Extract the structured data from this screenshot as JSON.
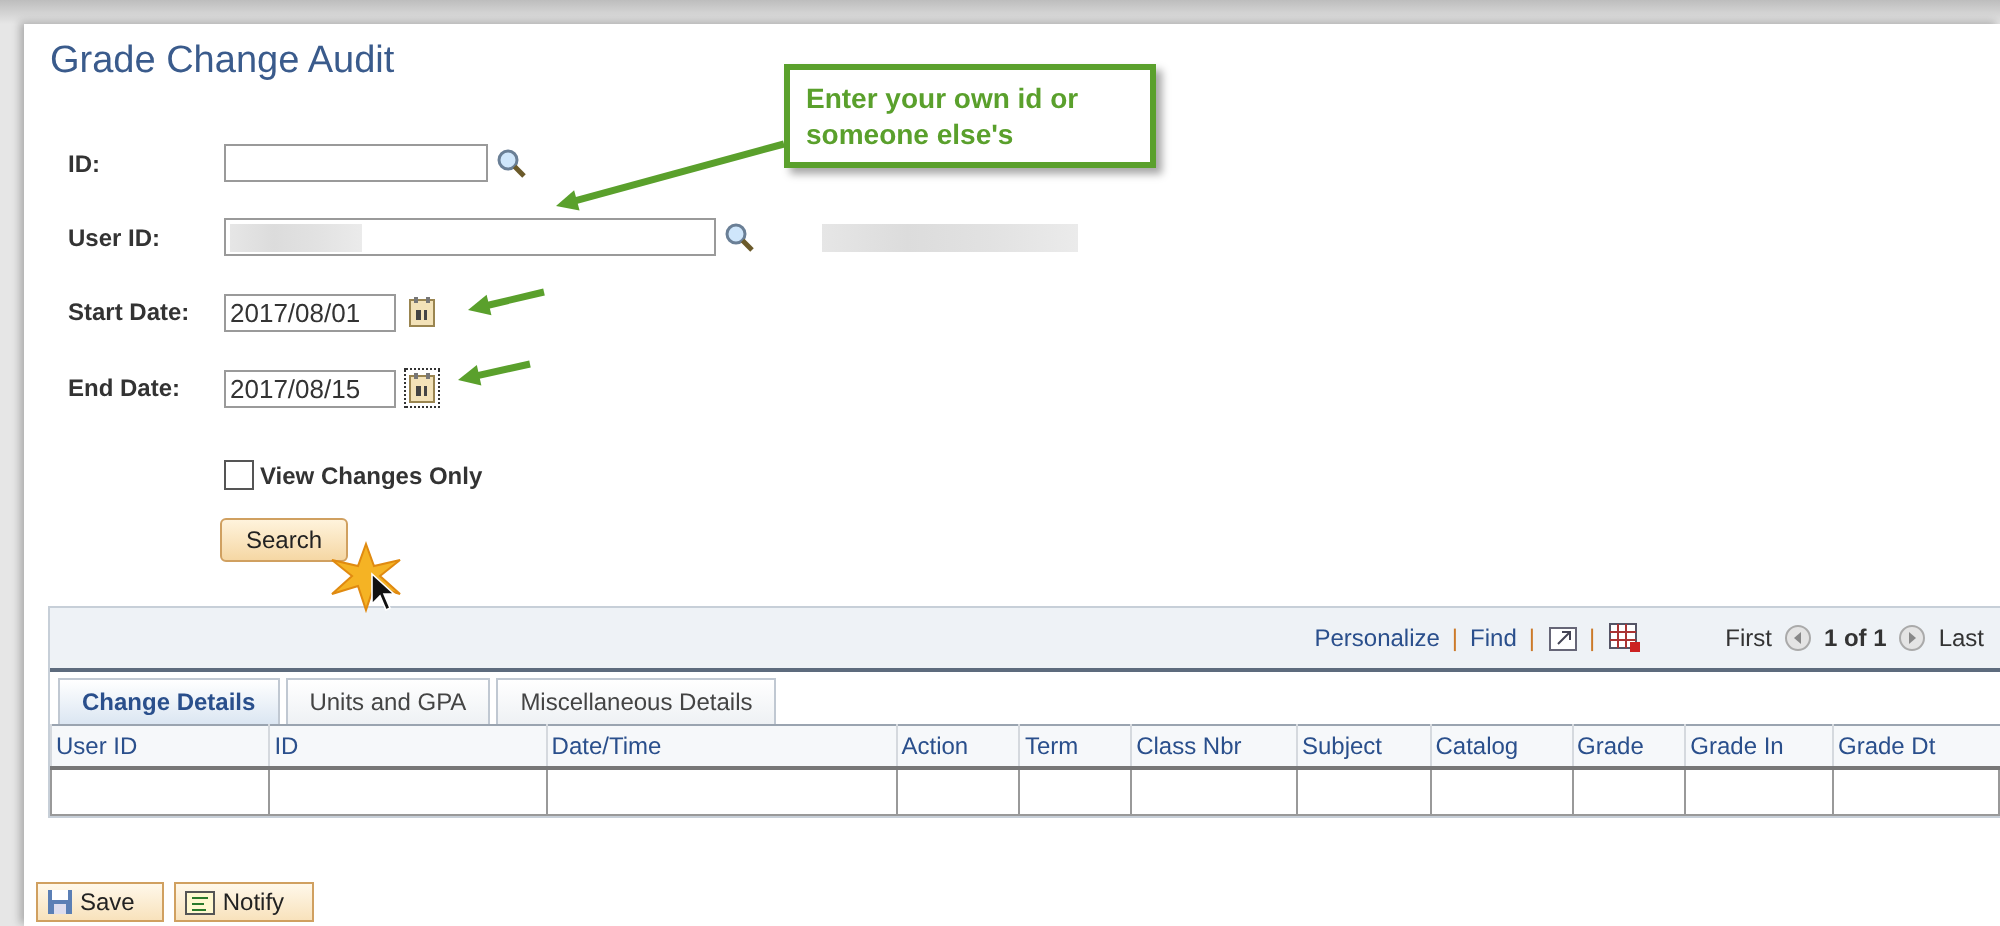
{
  "page_title": "Grade Change Audit",
  "callout": {
    "text": "Enter your own id or someone else's"
  },
  "fields": [
    {
      "kind": "lookup",
      "label": "ID:",
      "redacted": false,
      "wide": false
    },
    {
      "kind": "lookup",
      "label": "User ID:",
      "redacted": true,
      "wide": true
    },
    {
      "kind": "date",
      "label": "Start Date:",
      "value": "2017/08/01",
      "focused": false
    },
    {
      "kind": "date",
      "label": "End Date:",
      "value": "2017/08/15",
      "focused": true
    }
  ],
  "view_changes_only": {
    "label": "View Changes Only",
    "checked": false
  },
  "search_button": "Search",
  "grid": {
    "toolbar": {
      "personalize": "Personalize",
      "separators": [
        "|",
        "|",
        "|"
      ],
      "find": "Find",
      "first": "First",
      "page": "1 of 1",
      "last": "Last"
    },
    "tabs": [
      {
        "label": "Change Details",
        "selected": true
      },
      {
        "label": "Units and GPA",
        "selected": false
      },
      {
        "label": "Miscellaneous Details",
        "selected": false
      }
    ],
    "columns": [
      "User ID",
      "ID",
      "Date/Time",
      "Action",
      "Term",
      "Class Nbr",
      "Subject",
      "Catalog",
      "Grade",
      "Grade In",
      "Grade Dt"
    ]
  },
  "buttons": [
    {
      "kind": "save",
      "label": "Save"
    },
    {
      "kind": "notify",
      "label": "Notify"
    }
  ]
}
